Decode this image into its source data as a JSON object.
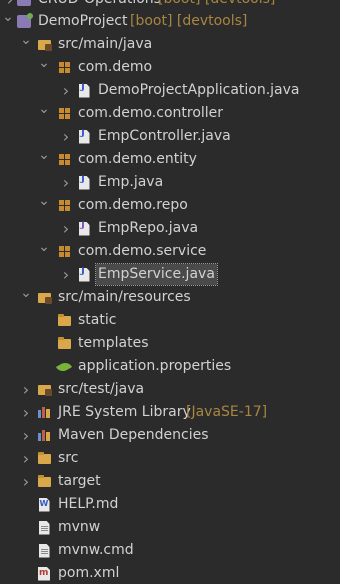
{
  "tree": {
    "partial_top": {
      "label": "CRUD-Operations",
      "deco": "[boot] [devtools]"
    },
    "project": {
      "label": "DemoProject",
      "deco": "[boot] [devtools]"
    },
    "src_main_java": {
      "label": "src/main/java"
    },
    "pkg_demo": {
      "label": "com.demo"
    },
    "file_app": {
      "label": "DemoProjectApplication.java"
    },
    "pkg_controller": {
      "label": "com.demo.controller"
    },
    "file_controller": {
      "label": "EmpController.java"
    },
    "pkg_entity": {
      "label": "com.demo.entity"
    },
    "file_entity": {
      "label": "Emp.java"
    },
    "pkg_repo": {
      "label": "com.demo.repo"
    },
    "file_repo": {
      "label": "EmpRepo.java"
    },
    "pkg_service": {
      "label": "com.demo.service"
    },
    "file_service": {
      "label": "EmpService.java"
    },
    "src_main_resources": {
      "label": "src/main/resources"
    },
    "folder_static": {
      "label": "static"
    },
    "folder_templates": {
      "label": "templates"
    },
    "file_props": {
      "label": "application.properties"
    },
    "src_test_java": {
      "label": "src/test/java"
    },
    "jre": {
      "label": "JRE System Library",
      "deco": "[JavaSE-17]"
    },
    "maven": {
      "label": "Maven Dependencies"
    },
    "folder_src": {
      "label": "src"
    },
    "folder_target": {
      "label": "target"
    },
    "file_help": {
      "label": "HELP.md"
    },
    "file_mvnw": {
      "label": "mvnw"
    },
    "file_mvnw_cmd": {
      "label": "mvnw.cmd"
    },
    "file_pom": {
      "label": "pom.xml"
    }
  },
  "icons": {
    "project": "project-icon",
    "source_folder": "source-folder-icon",
    "package": "package-icon",
    "java_class": "java-class-icon",
    "java_interface": "java-interface-icon",
    "folder": "folder-icon",
    "properties": "leaf-icon",
    "library": "library-icon",
    "file": "file-icon",
    "markdown": "word-file-icon",
    "maven_pom": "maven-pom-icon"
  },
  "colors": {
    "background": "#2b2b2b",
    "text": "#d2d2d2",
    "decoration": "#a8863f",
    "selection": "#4a4a4a"
  },
  "selected_item": "EmpService.java"
}
